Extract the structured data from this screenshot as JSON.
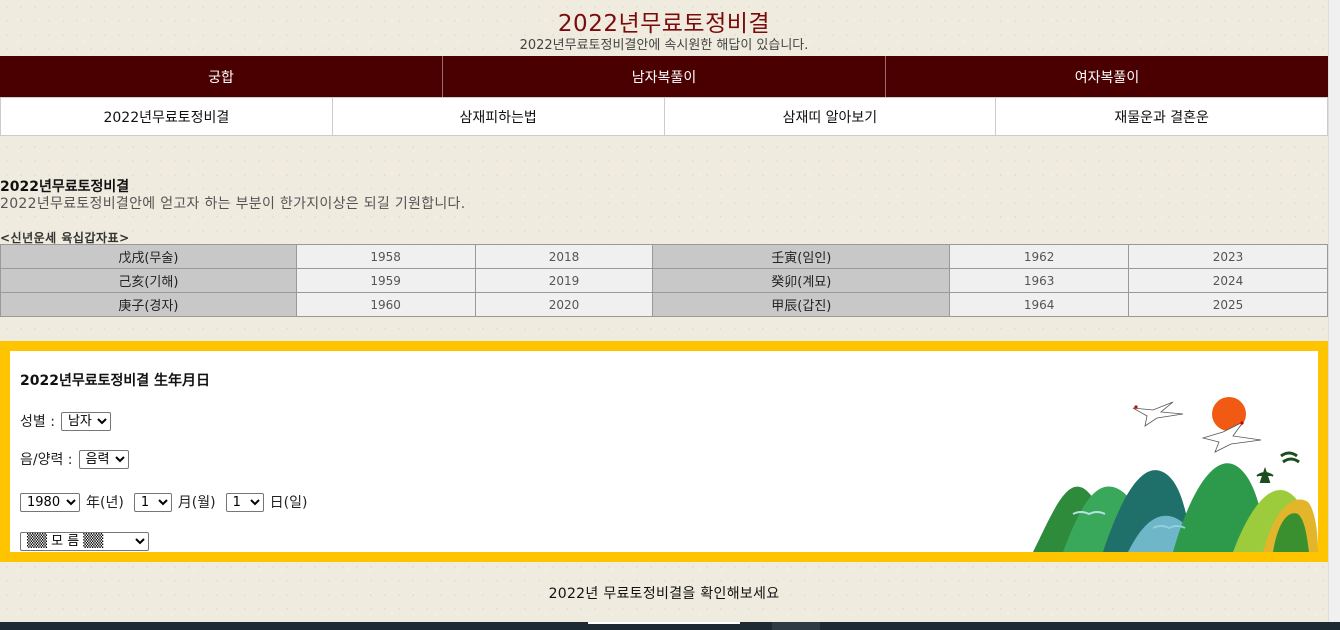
{
  "header": {
    "title": "2022년무료토정비결",
    "subtitle": "2022년무료토정비결안에 속시원한 해답이 있습니다."
  },
  "nav_primary": [
    {
      "label": "궁합"
    },
    {
      "label": "남자복풀이"
    },
    {
      "label": "여자복풀이"
    }
  ],
  "nav_secondary": [
    {
      "label": "2022년무료토정비결"
    },
    {
      "label": "삼재피하는법"
    },
    {
      "label": "삼재띠 알아보기"
    },
    {
      "label": "재물운과 결혼운"
    }
  ],
  "section": {
    "title": "2022년무료토정비결",
    "description": "2022년무료토정비결안에 얻고자 하는 부분이 한가지이상은 되길 기원합니다."
  },
  "gapja_table": {
    "caption": "<신년운세 육십갑자표>",
    "rows": [
      [
        "戊戌(무술)",
        "1958",
        "2018",
        "壬寅(임인)",
        "1962",
        "2023"
      ],
      [
        "己亥(기해)",
        "1959",
        "2019",
        "癸卯(계묘)",
        "1963",
        "2024"
      ],
      [
        "庚子(경자)",
        "1960",
        "2020",
        "甲辰(갑진)",
        "1964",
        "2025"
      ]
    ]
  },
  "form": {
    "title": "2022년무료토정비결 生年月日",
    "gender_label": "성별 :",
    "gender_value": "남자",
    "calendar_label": "음/양력 :",
    "calendar_value": "음력",
    "year_value": "1980",
    "year_label": "年(년)",
    "month_value": "1",
    "month_label": "月(월)",
    "day_value": "1",
    "day_label": "日(일)",
    "hour_value": "▒▒ 모 름 ▒▒"
  },
  "footer_message": "2022년 무료토정비결을  확인해보세요",
  "colors": {
    "accent": "#4a0000",
    "title": "#7a0b0b",
    "form_border": "#ffc400",
    "background": "#efebdf"
  }
}
